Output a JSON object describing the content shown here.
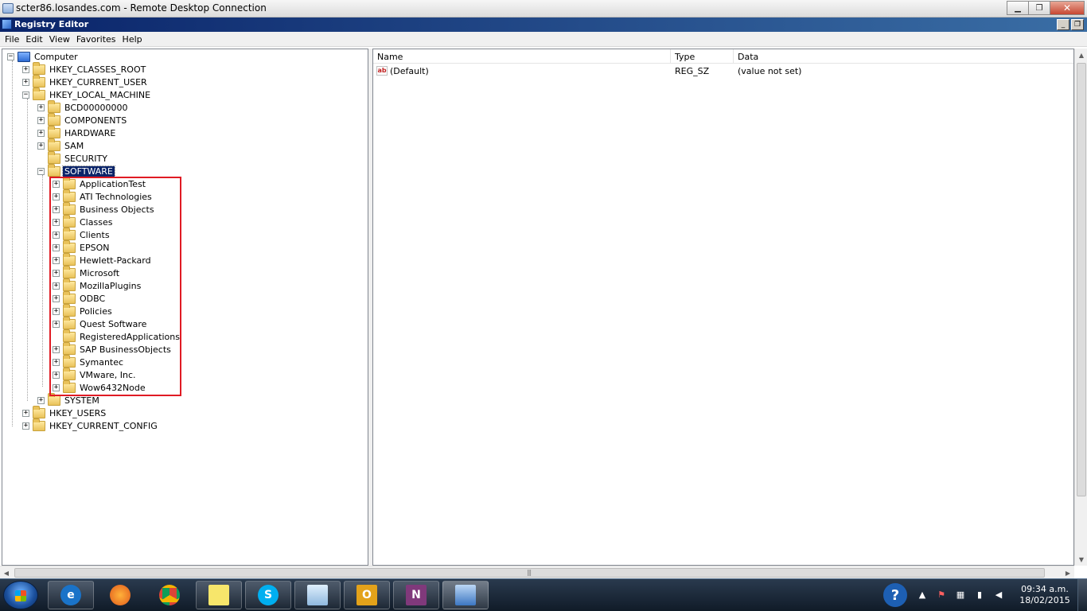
{
  "rdc": {
    "title": "scter86.losandes.com - Remote Desktop Connection"
  },
  "app": {
    "title": "Registry Editor"
  },
  "menu": [
    "File",
    "Edit",
    "View",
    "Favorites",
    "Help"
  ],
  "tree": {
    "root": "Computer",
    "hives": {
      "classes_root": "HKEY_CLASSES_ROOT",
      "current_user": "HKEY_CURRENT_USER",
      "local_machine": "HKEY_LOCAL_MACHINE",
      "users": "HKEY_USERS",
      "current_config": "HKEY_CURRENT_CONFIG"
    },
    "hklm_children": [
      "BCD00000000",
      "COMPONENTS",
      "HARDWARE",
      "SAM",
      "SECURITY",
      "SOFTWARE",
      "SYSTEM"
    ],
    "software_children": [
      "ApplicationTest",
      "ATI Technologies",
      "Business Objects",
      "Classes",
      "Clients",
      "EPSON",
      "Hewlett-Packard",
      "Microsoft",
      "MozillaPlugins",
      "ODBC",
      "Policies",
      "Quest Software",
      "RegisteredApplications",
      "SAP BusinessObjects",
      "Symantec",
      "VMware, Inc.",
      "Wow6432Node"
    ],
    "selected": "SOFTWARE",
    "highlight_color": "#e01b24"
  },
  "list": {
    "columns": [
      "Name",
      "Type",
      "Data"
    ],
    "rows": [
      {
        "name": "(Default)",
        "type": "REG_SZ",
        "data": "(value not set)"
      }
    ]
  },
  "taskbar": {
    "apps": [
      "internet-explorer-icon",
      "firefox-icon",
      "chrome-icon",
      "sticky-notes-icon",
      "skype-icon",
      "notepad-icon",
      "outlook-icon",
      "onenote-icon",
      "remote-desktop-icon"
    ],
    "clock_time": "09:34 a.m.",
    "clock_date": "18/02/2015"
  }
}
